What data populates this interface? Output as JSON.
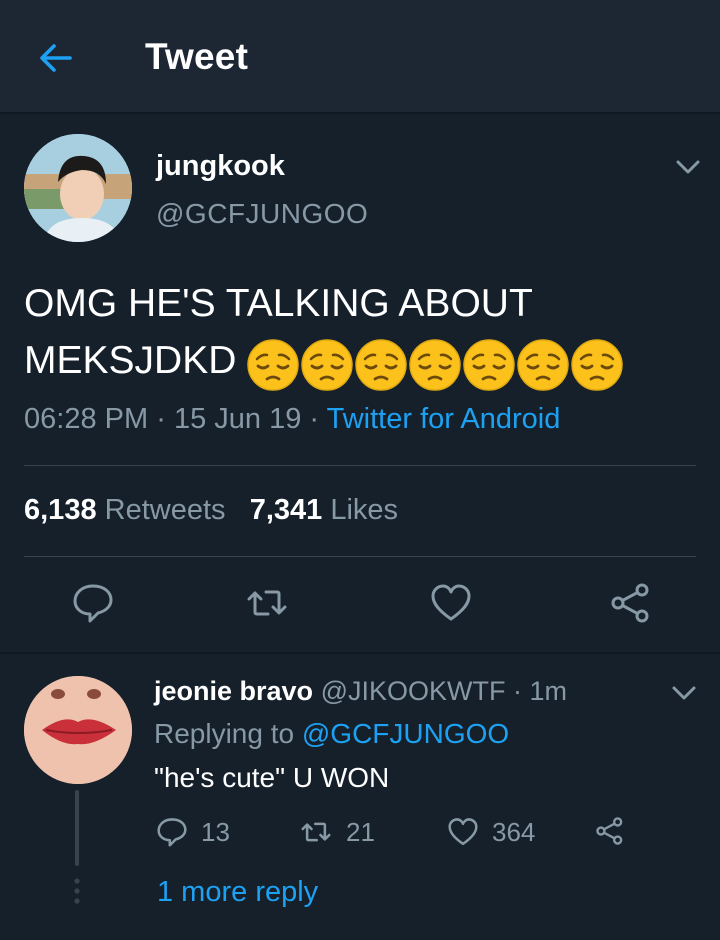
{
  "header": {
    "title": "Tweet",
    "back_icon": "arrow-left-icon"
  },
  "tweet": {
    "author_name": "jungkook",
    "author_handle": "@GCFJUNGOO",
    "text": "OMG HE'S TALKING ABOUT",
    "text_line2": "MEKSJDKD",
    "emoji_count": 7,
    "emoji_name": "pensive-face",
    "time": "06:28 PM",
    "date_sep": "·",
    "date": "15 Jun 19",
    "source_sep": "·",
    "source": "Twitter for Android",
    "retweets_count": "6,138",
    "retweets_label": "Retweets",
    "likes_count": "7,341",
    "likes_label": "Likes"
  },
  "reply": {
    "author_name": "jeonie bravo",
    "author_handle": "@JIKOOKWTF",
    "sep": "·",
    "time": "1m",
    "replying_label": "Replying to",
    "replying_to": "@GCFJUNGOO",
    "text": "\"he's cute\" U WON",
    "reply_count": "13",
    "retweet_count": "21",
    "like_count": "364",
    "more_replies": "1 more reply"
  },
  "colors": {
    "background": "#15202b",
    "header": "#1c2733",
    "accent": "#1da1f2",
    "muted": "#8899a6",
    "divider": "#38444d"
  }
}
